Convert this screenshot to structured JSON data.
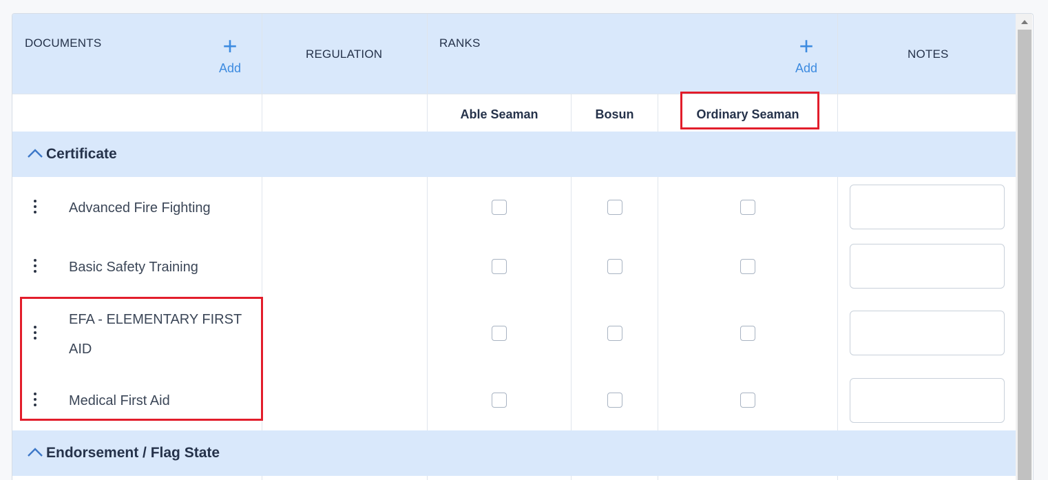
{
  "header": {
    "documents": "DOCUMENTS",
    "regulation": "REGULATION",
    "ranks": "RANKS",
    "notes": "NOTES",
    "add_label": "Add",
    "add_plus": "+"
  },
  "ranks": [
    "Able Seaman",
    "Bosun",
    "Ordinary Seaman"
  ],
  "groups": {
    "certificate": "Certificate",
    "endorsement": "Endorsement / Flag State"
  },
  "documents": [
    {
      "line1": "Advanced Fire Fighting",
      "line2": ""
    },
    {
      "line1": "Basic Safety Training",
      "line2": ""
    },
    {
      "line1": "EFA - ELEMENTARY FIRST",
      "line2": "AID"
    },
    {
      "line1": "Medical First Aid",
      "line2": ""
    }
  ],
  "notes_values": [
    "",
    "",
    "",
    ""
  ],
  "colors": {
    "header_bg": "#d9e8fb",
    "accent": "#3d8be0",
    "highlight": "#e21d2b"
  }
}
